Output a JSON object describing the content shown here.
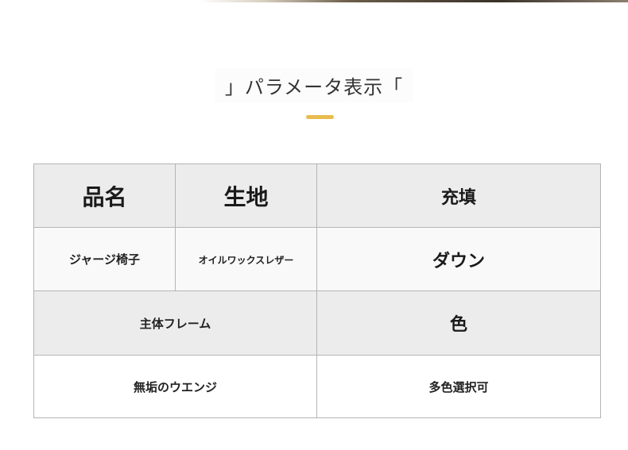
{
  "title": "」パラメータ表示「",
  "accent_color": "#e8bd4e",
  "table": {
    "row1": {
      "name_label": "品名",
      "fabric_label": "生地",
      "filling_label": "充填"
    },
    "row2": {
      "name_value": "ジャージ椅子",
      "fabric_value": "オイルワックスレザー",
      "filling_value": "ダウン"
    },
    "row3": {
      "frame_label": "主体フレーム",
      "color_label": "色"
    },
    "row4": {
      "frame_value": "無垢のウエンジ",
      "color_value": "多色選択可"
    }
  }
}
